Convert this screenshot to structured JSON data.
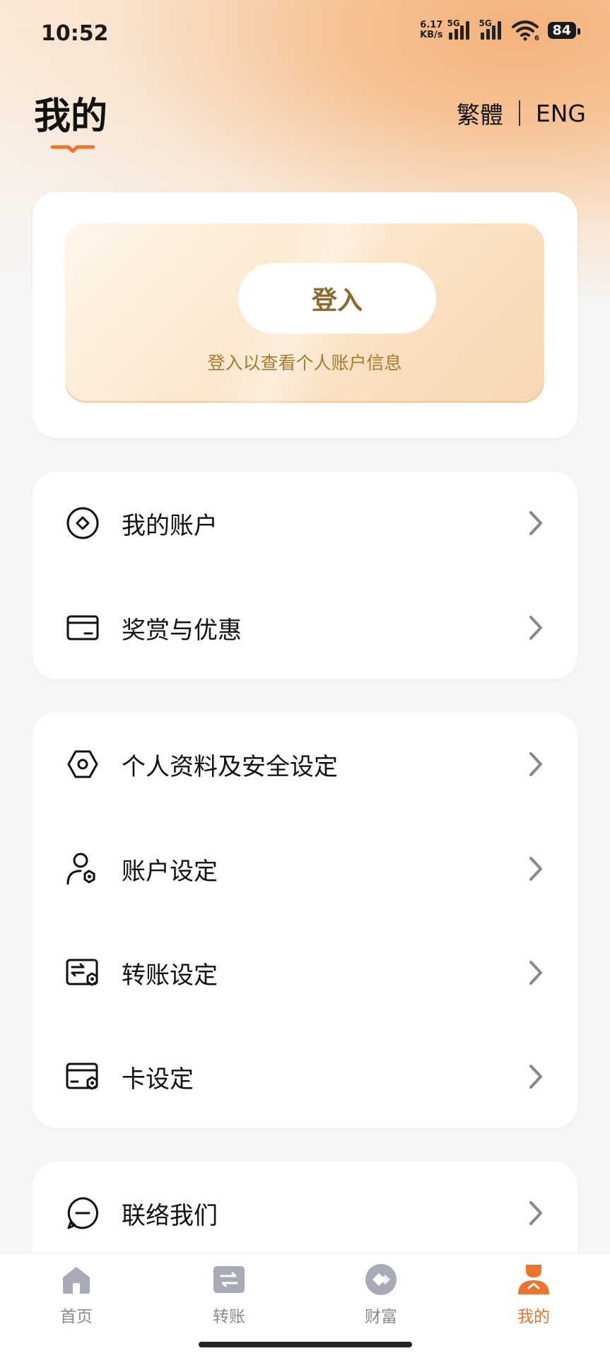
{
  "status": {
    "time": "10:52",
    "net_speed_value": "6.17",
    "net_speed_unit": "KB/s",
    "signal1_label": "5G",
    "signal2_label": "5G",
    "wifi_sub": "6",
    "battery": "84"
  },
  "header": {
    "title": "我的",
    "lang_traditional": "繁體",
    "lang_english": "ENG"
  },
  "login": {
    "button_label": "登入",
    "hint": "登入以查看个人账户信息"
  },
  "menu_a": [
    {
      "label": "我的账户",
      "icon": "diamond-circle-icon"
    },
    {
      "label": "奖赏与优惠",
      "icon": "card-icon"
    }
  ],
  "menu_b": [
    {
      "label": "个人资料及安全设定",
      "icon": "hexagon-icon"
    },
    {
      "label": "账户设定",
      "icon": "user-settings-icon"
    },
    {
      "label": "转账设定",
      "icon": "transfer-settings-icon"
    },
    {
      "label": "卡设定",
      "icon": "card-settings-icon"
    }
  ],
  "menu_c": [
    {
      "label": "联络我们",
      "icon": "chat-icon"
    }
  ],
  "tabs": [
    {
      "label": "首页",
      "icon": "home-icon"
    },
    {
      "label": "转账",
      "icon": "transfer-icon"
    },
    {
      "label": "财富",
      "icon": "wealth-icon"
    },
    {
      "label": "我的",
      "icon": "profile-icon"
    }
  ],
  "colors": {
    "accent": "#e8742d",
    "login_text": "#8a6a2e",
    "hint_text": "#a9792f",
    "tab_inactive": "#8a8a8a"
  }
}
